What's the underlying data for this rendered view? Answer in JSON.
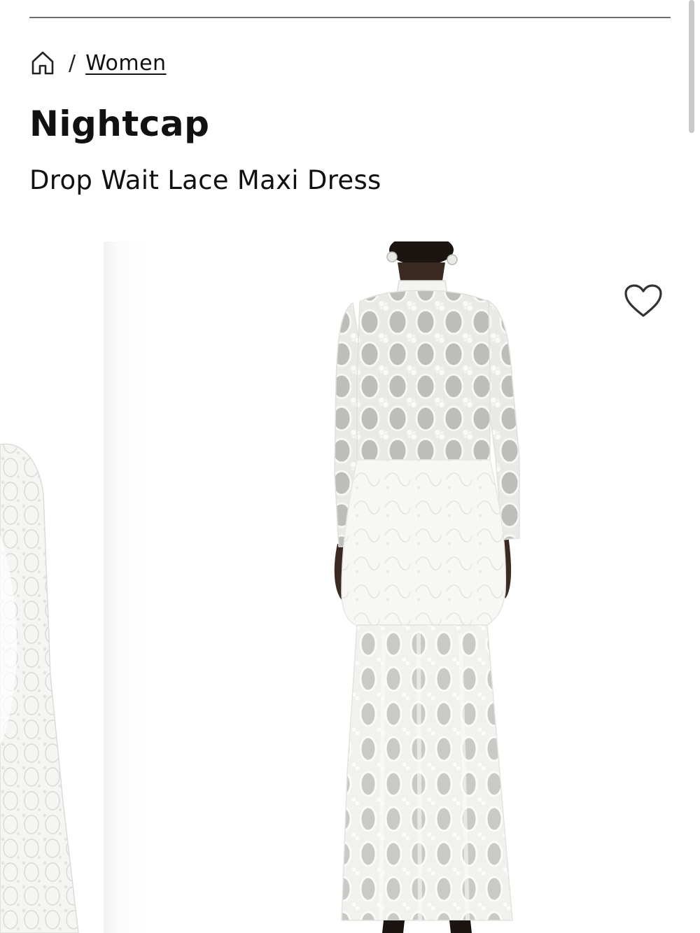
{
  "breadcrumb": {
    "home_icon": "home-icon",
    "separator": "/",
    "category": "Women"
  },
  "product": {
    "brand": "Nightcap",
    "name": "Drop Wait Lace Maxi Dress",
    "color": "white"
  },
  "gallery": {
    "main_image": "model wearing white lace maxi dress, back view",
    "previous_image": "partial side view of white lace dress",
    "wishlist_icon": "heart-outline-icon"
  },
  "colors": {
    "text": "#111111",
    "rule": "#6e6e6e",
    "lace": "#f4f4f2",
    "skin": "#3a2a22",
    "background": "#ffffff"
  }
}
